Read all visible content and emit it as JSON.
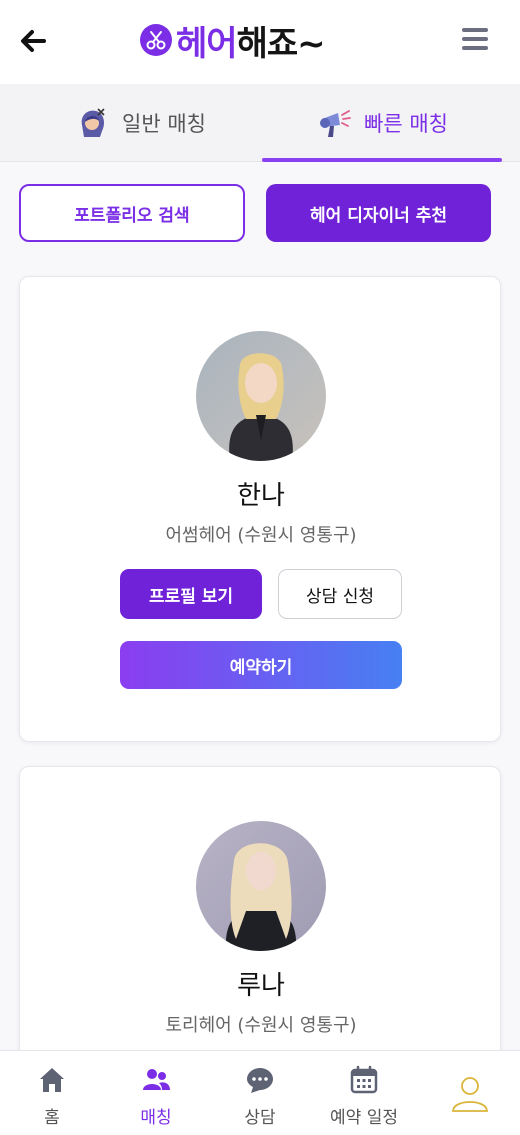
{
  "header": {
    "back_icon": "arrow-left-icon",
    "logo_icon": "scissors-icon",
    "logo_text_part1": "헤어",
    "logo_text_part2": "해",
    "logo_text_part3": "죠~",
    "menu_icon": "hamburger-menu-icon"
  },
  "tabs": [
    {
      "label": "일반 매칭",
      "icon": "hair-cut-person-icon",
      "active": false
    },
    {
      "label": "빠른 매칭",
      "icon": "hair-dryer-icon",
      "active": true
    }
  ],
  "actions": {
    "portfolio_search": "포트폴리오 검색",
    "designer_recommend": "헤어 디자이너 추천"
  },
  "designers": [
    {
      "name": "한나",
      "salon": "어썸헤어 (수원시 영통구)",
      "profile_label": "프로필 보기",
      "consult_label": "상담 신청",
      "book_label": "예약하기"
    },
    {
      "name": "루나",
      "salon": "토리헤어 (수원시 영통구)"
    }
  ],
  "bottom_nav": [
    {
      "label": "홈",
      "icon": "home-icon",
      "active": false
    },
    {
      "label": "매칭",
      "icon": "users-icon",
      "active": true
    },
    {
      "label": "상담",
      "icon": "chat-bubble-icon",
      "active": false
    },
    {
      "label": "예약 일정",
      "icon": "calendar-icon",
      "active": false
    },
    {
      "label": "",
      "icon": "user-profile-icon",
      "active": false
    }
  ],
  "colors": {
    "primary": "#7b2ee6",
    "primary_dark": "#6f22d8",
    "gradient_start": "#8b3df0",
    "gradient_end": "#4780f3"
  }
}
